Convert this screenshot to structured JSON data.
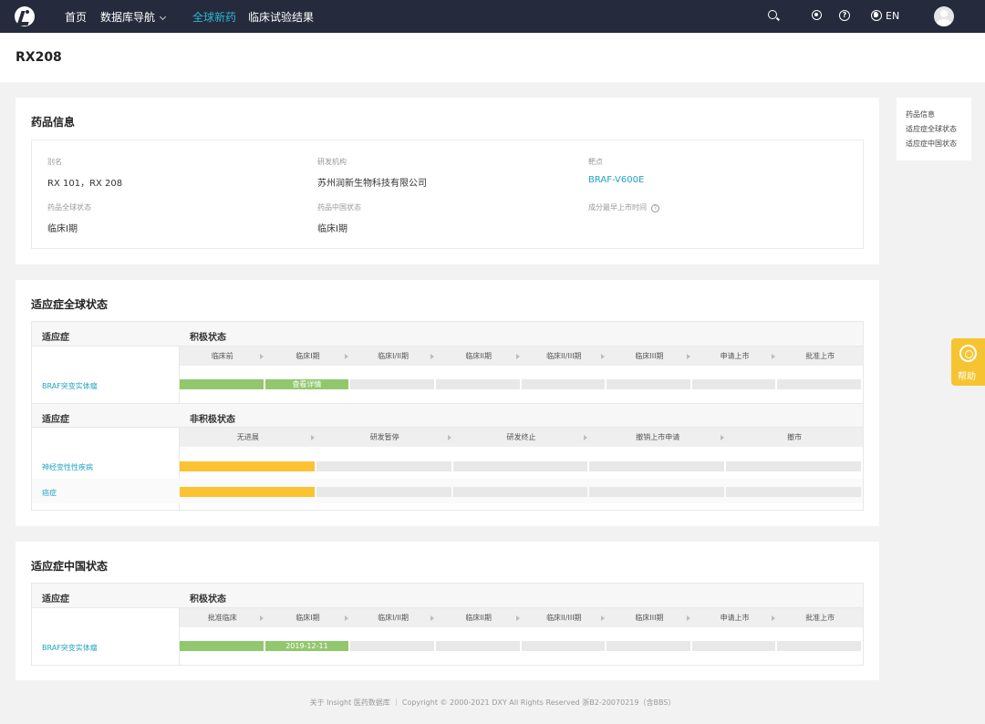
{
  "nav": {
    "home": "首页",
    "db_nav": "数据库导航",
    "global_drugs": "全球新药",
    "clinical": "临床试验结果",
    "lang": "EN"
  },
  "page": {
    "title": "RX208"
  },
  "drug_info": {
    "title": "药品信息",
    "alias_label": "别名",
    "alias_value": "RX 101，RX 208",
    "org_label": "研发机构",
    "org_value": "苏州润新生物科技有限公司",
    "target_label": "靶点",
    "target_value": "BRAF-V600E",
    "global_status_label": "药品全球状态",
    "global_status_value": "临床I期",
    "china_status_label": "药品中国状态",
    "china_status_value": "临床I期",
    "earliest_label": "成分最早上市时间"
  },
  "toc": {
    "items": [
      "药品信息",
      "适应症全球状态",
      "适应症中国状态"
    ]
  },
  "help": {
    "label": "帮助"
  },
  "global_section": {
    "title": "适应症全球状态",
    "col_indication": "适应症",
    "active_label": "积极状态",
    "active_stages": [
      "临床前",
      "临床I期",
      "临床I/II期",
      "临床II期",
      "临床II/III期",
      "临床III期",
      "申请上市",
      "批准上市"
    ],
    "active_rows": [
      {
        "name": "BRAF突变实体瘤",
        "progress_stages": 2,
        "detail_label": "查看详情"
      }
    ],
    "inactive_label": "非积极状态",
    "inactive_stages": [
      "无进展",
      "研发暂停",
      "研发终止",
      "撤销上市申请",
      "撤市"
    ],
    "inactive_rows": [
      {
        "name": "神经变性性疾病",
        "progress_stages": 1
      },
      {
        "name": "癌症",
        "progress_stages": 1
      }
    ]
  },
  "china_section": {
    "title": "适应症中国状态",
    "col_indication": "适应症",
    "active_label": "积极状态",
    "active_stages": [
      "批准临床",
      "临床I期",
      "临床I/II期",
      "临床II期",
      "临床II/III期",
      "临床III期",
      "申请上市",
      "批准上市"
    ],
    "active_rows": [
      {
        "name": "BRAF突变实体瘤",
        "progress_stages": 2,
        "date_label": "2019-12-11"
      }
    ]
  },
  "colors": {
    "brand_link": "#21a4c3",
    "progress_green": "#92c86d",
    "progress_yellow": "#fbc232",
    "nav_bg": "#252b3c",
    "help_bg": "#f6c431"
  },
  "footer": {
    "text": "关于 Insight 医药数据库 ｜ Copyright © 2000-2021 DXY All Rights Reserved  浙B2-20070219（含BBS）"
  }
}
